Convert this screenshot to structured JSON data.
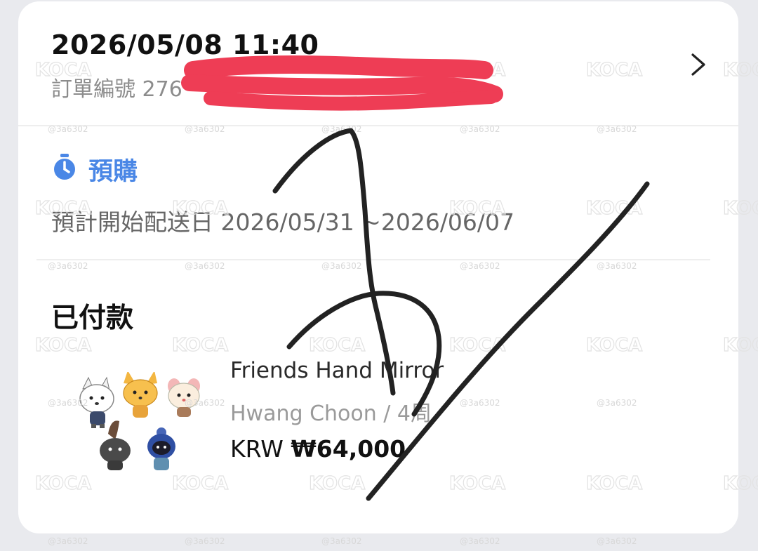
{
  "order": {
    "datetime": "2026/05/08 11:40",
    "number_label": "訂單編號 276"
  },
  "preorder": {
    "label": "預購",
    "shipping_text": "預計開始配送日 2026/05/31 ~2026/06/07"
  },
  "payment": {
    "status": "已付款"
  },
  "product": {
    "name": "Friends Hand Mirror",
    "variant": "Hwang Choon / 4周",
    "currency": "KRW",
    "price": "₩64,000"
  },
  "watermark": {
    "logo": "KOCA",
    "handle": "@3a6302"
  },
  "colors": {
    "accent": "#4a87e6",
    "redaction": "#ee3d55",
    "signature": "#222222"
  },
  "icons": [
    "stopwatch-icon",
    "chevron-right-icon"
  ]
}
